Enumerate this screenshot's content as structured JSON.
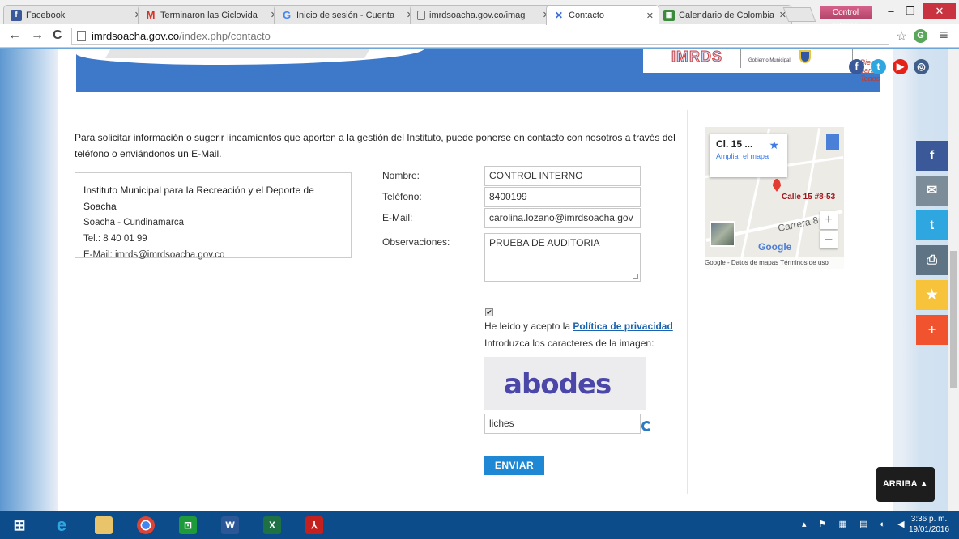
{
  "browser": {
    "tabs": [
      {
        "title": "Facebook",
        "icon": "facebook-favicon",
        "color": "#3b5998",
        "glyph": "f"
      },
      {
        "title": "Terminaron las Ciclovida",
        "icon": "gmail-favicon",
        "color": "#d93025",
        "glyph": "M"
      },
      {
        "title": "Inicio de sesión - Cuenta",
        "icon": "google-favicon",
        "color": "#4285f4",
        "glyph": "G"
      },
      {
        "title": "imrdsoacha.gov.co/imag",
        "icon": "page-favicon",
        "color": "#777777",
        "glyph": "▢"
      },
      {
        "title": "Contacto",
        "icon": "joomla-favicon",
        "color": "#3b6fd6",
        "glyph": "✕"
      },
      {
        "title": "Calendario de Colombia",
        "icon": "calendar-favicon",
        "color": "#3c8a3c",
        "glyph": "▦"
      }
    ],
    "active_tab": 4,
    "user_badge": "Control Interno",
    "url_host": "imrdsoacha.gov.co",
    "url_path": "/index.php/contacto"
  },
  "page": {
    "intro": "Para solicitar información o sugerir lineamientos que aporten a la gestión del Instituto, puede ponerse en contacto con nosotros  a través del teléfono o enviándonos un E-Mail.",
    "address": {
      "org": "Instituto Municipal para la Recreación y el Deporte de Soacha",
      "city": "Soacha - Cundinamarca",
      "phone": "Tel.: 8 40 01 99",
      "email": "E-Mail: imrds@imrdsoacha.gov.co"
    },
    "form": {
      "name_label": "Nombre:",
      "name_value": "CONTROL INTERNO",
      "phone_label": "Teléfono:",
      "phone_value": "8400199",
      "email_label": "E-Mail:",
      "email_value": "carolina.lozano@imrdsoacha.gov",
      "notes_label": "Observaciones:",
      "notes_value": "PRUEBA DE AUDITORIA",
      "accept_prefix": "He leído y acepto la ",
      "privacy_link": "Política de privacidad",
      "captcha_prompt": "Introduzca los caracteres de la imagen:",
      "captcha_image_text": "abodes",
      "captcha_value": "liches",
      "submit_label": "ENVIAR"
    },
    "map": {
      "place_title": "Cl. 15 ...",
      "expand_link": "Ampliar el mapa",
      "pin_label": "Calle 15 #8-53",
      "street_label": "Carrera 8",
      "google": "Google",
      "footer": "Google - Datos de mapas   Términos de uso"
    },
    "banner": {
      "logo_imrds": "IMRDS",
      "logo_gob": "Gobierno Municipal",
      "logo_soacha": "Bienestar para Todos"
    },
    "share_buttons": [
      {
        "icon": "facebook-icon",
        "glyph": "f",
        "color": "#3b5998"
      },
      {
        "icon": "mail-icon",
        "glyph": "✉",
        "color": "#7d8c99"
      },
      {
        "icon": "twitter-icon",
        "glyph": "🐦",
        "color": "#2ea7e0"
      },
      {
        "icon": "print-icon",
        "glyph": "⎙",
        "color": "#5e7384"
      },
      {
        "icon": "star-icon",
        "glyph": "★",
        "color": "#f7c33b"
      },
      {
        "icon": "plus-icon",
        "glyph": "+",
        "color": "#f0532e"
      }
    ],
    "back_to_top": "ARRIBA ▲"
  },
  "taskbar": {
    "time": "3:36 p. m.",
    "date": "19/01/2016"
  }
}
